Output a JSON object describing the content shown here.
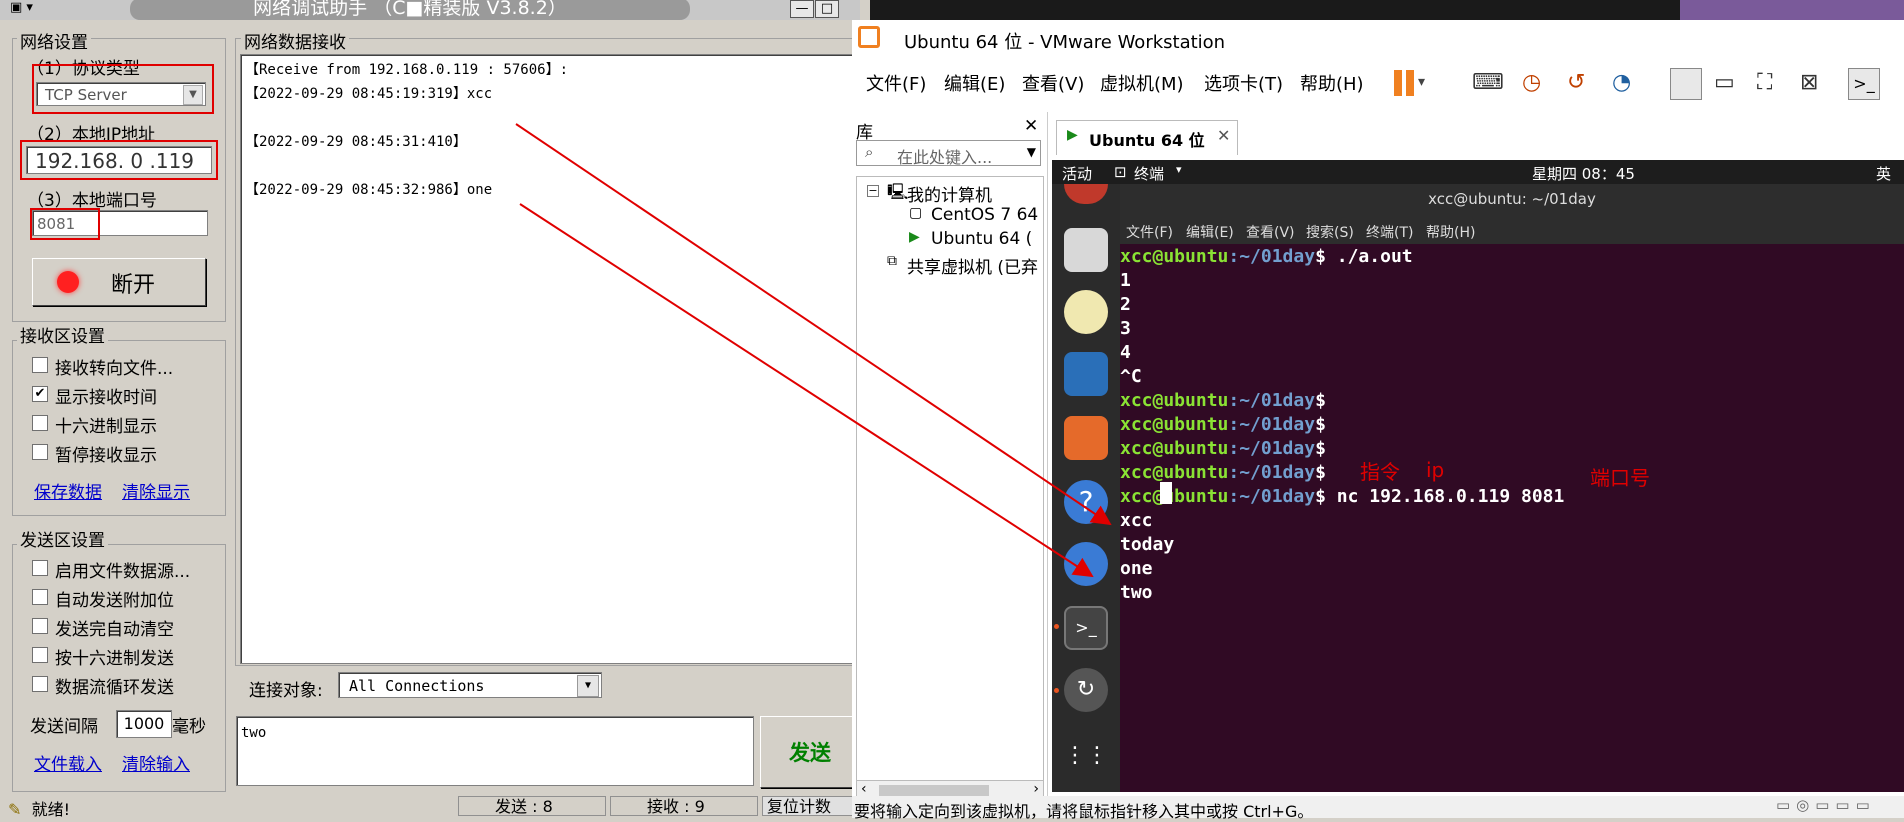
{
  "left_app": {
    "title": "网络调试助手 （C■精装版 V3.8.2）",
    "net_settings": {
      "label": "网络设置",
      "protocol_label": "（1）协议类型",
      "protocol_value": "TCP Server",
      "ip_label": "（2）本地IP地址",
      "ip_value": "192.168. 0 .119",
      "port_label": "（3）本地端口号",
      "port_value": "8081",
      "disconnect_label": "断开"
    },
    "recv_settings": {
      "label": "接收区设置",
      "options": [
        {
          "label": "接收转向文件...",
          "checked": false
        },
        {
          "label": "显示接收时间",
          "checked": true
        },
        {
          "label": "十六进制显示",
          "checked": false
        },
        {
          "label": "暂停接收显示",
          "checked": false
        }
      ],
      "save_link": "保存数据",
      "clear_link": "清除显示"
    },
    "send_settings": {
      "label": "发送区设置",
      "options": [
        {
          "label": "启用文件数据源...",
          "checked": false
        },
        {
          "label": "自动发送附加位",
          "checked": false
        },
        {
          "label": "发送完自动清空",
          "checked": false
        },
        {
          "label": "按十六进制发送",
          "checked": false
        },
        {
          "label": "数据流循环发送",
          "checked": false
        }
      ],
      "interval_label": "发送间隔",
      "interval_value": "1000",
      "interval_unit": "毫秒",
      "load_link": "文件载入",
      "clear_input_link": "清除输入"
    },
    "recv_area": {
      "label": "网络数据接收",
      "lines": [
        "【Receive from 192.168.0.119 : 57606】:",
        "【2022-09-29 08:45:19:319】xcc",
        "",
        "【2022-09-29 08:45:31:410】",
        "",
        "【2022-09-29 08:45:32:986】one"
      ]
    },
    "connect_target_label": "连接对象:",
    "connect_target_value": "All Connections",
    "send_text": "two",
    "send_button": "发送",
    "status": {
      "ready": "就绪!",
      "sent_label": "发送 : 8",
      "recv_label": "接收 : 9",
      "reset_label": "复位计数"
    }
  },
  "vmware": {
    "title": "Ubuntu 64 位 - VMware Workstation",
    "menu": [
      "文件(F)",
      "编辑(E)",
      "查看(V)",
      "虚拟机(M)",
      "选项卡(T)",
      "帮助(H)"
    ],
    "library": {
      "label": "库",
      "search_placeholder": "在此处键入...",
      "tree": [
        "我的计算机",
        "CentOS 7 64",
        "Ubuntu 64 (",
        "共享虚拟机 (已弃"
      ]
    },
    "tab_label": "Ubuntu 64 位",
    "status_text": "要将输入定向到该虚拟机，请将鼠标指针移入其中或按 Ctrl+G。"
  },
  "ubuntu": {
    "activities": "活动",
    "terminal_menu": "终端",
    "clock": "星期四 08：45",
    "lang": "英",
    "window_title": "xcc@ubuntu: ~/01day",
    "term_menu": [
      "文件(F)",
      "编辑(E)",
      "查看(V)",
      "搜索(S)",
      "终端(T)",
      "帮助(H)"
    ],
    "prompt_user": "xcc@ubuntu",
    "prompt_path": ":~/01day",
    "prompt_sign": "$",
    "lines": [
      {
        "type": "prompt",
        "cmd": " ./a.out"
      },
      {
        "type": "out",
        "text": "1"
      },
      {
        "type": "out",
        "text": "2"
      },
      {
        "type": "out",
        "text": "3"
      },
      {
        "type": "out",
        "text": "4"
      },
      {
        "type": "out",
        "text": "^C"
      },
      {
        "type": "prompt",
        "cmd": ""
      },
      {
        "type": "prompt",
        "cmd": ""
      },
      {
        "type": "prompt",
        "cmd": ""
      },
      {
        "type": "prompt",
        "cmd": ""
      },
      {
        "type": "prompt",
        "cmd": " nc 192.168.0.119 8081"
      },
      {
        "type": "out",
        "text": "xcc"
      },
      {
        "type": "out",
        "text": "today"
      },
      {
        "type": "out",
        "text": "one"
      },
      {
        "type": "out",
        "text": "two"
      }
    ],
    "annotations": {
      "cmd": "指令",
      "ip": "ip",
      "port": "端口号"
    }
  },
  "colors": {
    "accent_red": "#e00000",
    "terminal_bg": "#300a24",
    "prompt_green": "#8ae234",
    "prompt_blue": "#729fcf"
  }
}
